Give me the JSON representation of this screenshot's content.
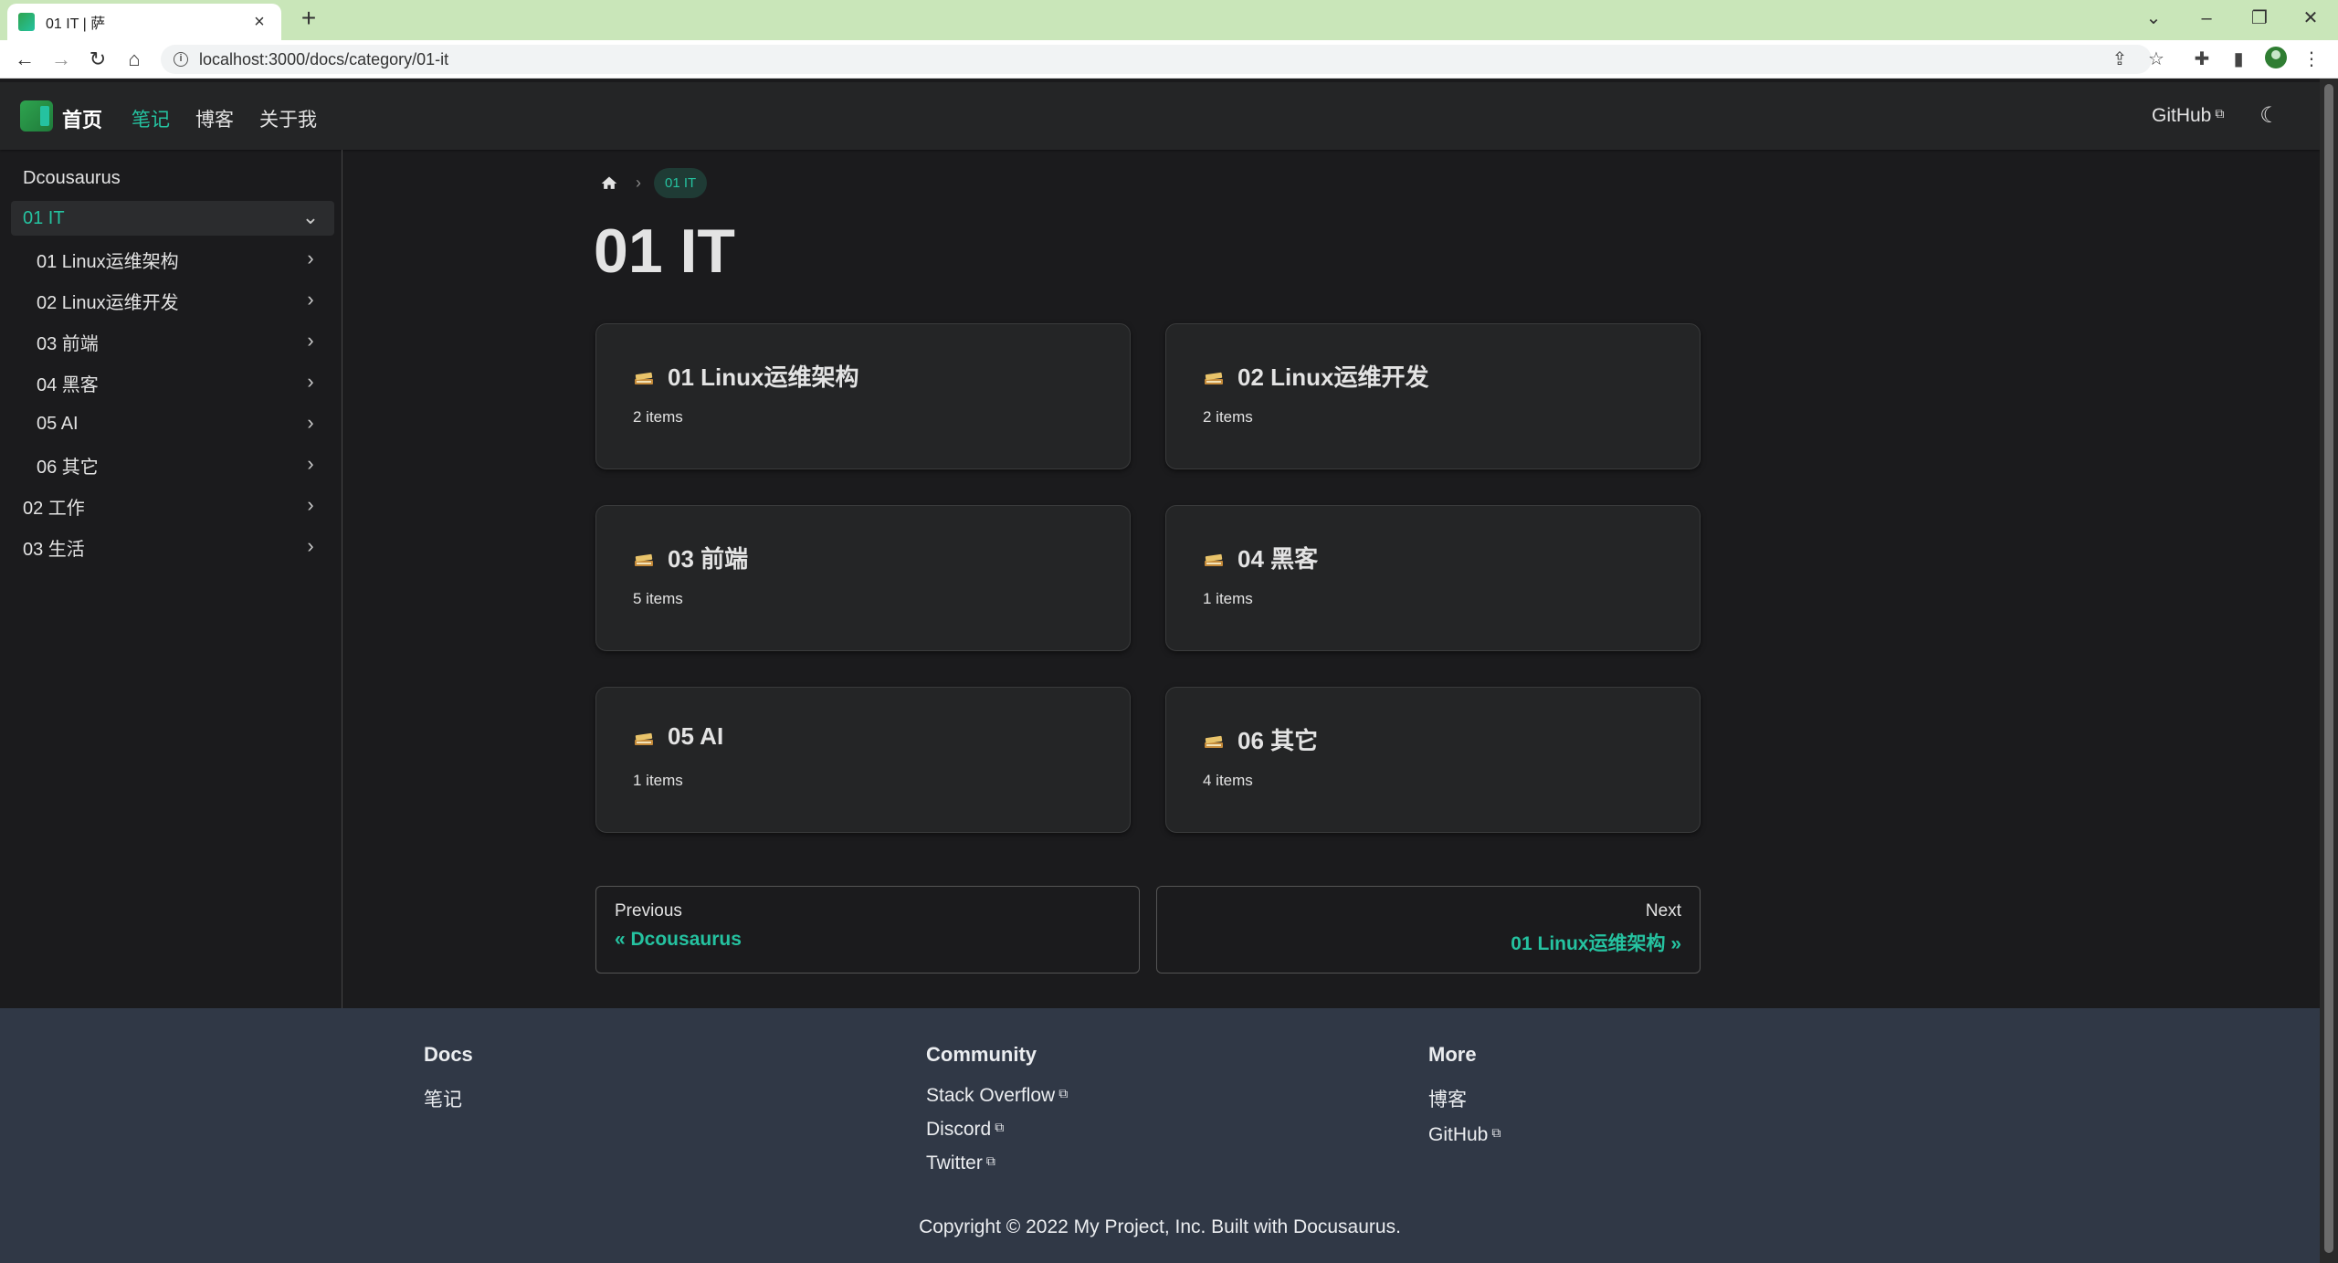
{
  "browser": {
    "tab_title": "01 IT | 萨",
    "url": "localhost:3000/docs/category/01-it"
  },
  "navbar": {
    "brand": "首页",
    "links": [
      "笔记",
      "博客",
      "关于我"
    ],
    "github": "GitHub"
  },
  "sidebar": {
    "items": [
      {
        "label": "Dcousaurus"
      },
      {
        "label": "01 IT"
      },
      {
        "label": "01 Linux运维架构"
      },
      {
        "label": "02 Linux运维开发"
      },
      {
        "label": "03 前端"
      },
      {
        "label": "04 黑客"
      },
      {
        "label": "05 AI"
      },
      {
        "label": "06 其它"
      },
      {
        "label": "02 工作"
      },
      {
        "label": "03 生活"
      }
    ]
  },
  "breadcrumb": {
    "current": "01 IT"
  },
  "page_title": "01 IT",
  "cards": [
    {
      "title": "01 Linux运维架构",
      "count": "2 items"
    },
    {
      "title": "02 Linux运维开发",
      "count": "2 items"
    },
    {
      "title": "03 前端",
      "count": "5 items"
    },
    {
      "title": "04 黑客",
      "count": "1 items"
    },
    {
      "title": "05 AI",
      "count": "1 items"
    },
    {
      "title": "06 其它",
      "count": "4 items"
    }
  ],
  "pagination": {
    "previous_label": "Previous",
    "previous_title": "« Dcousaurus",
    "next_label": "Next",
    "next_title": "01 Linux运维架构 »"
  },
  "footer": {
    "columns": [
      {
        "title": "Docs",
        "links": [
          "笔记"
        ]
      },
      {
        "title": "Community",
        "links": [
          "Stack Overflow",
          "Discord",
          "Twitter"
        ]
      },
      {
        "title": "More",
        "links": [
          "博客",
          "GitHub"
        ]
      }
    ],
    "copyright": "Copyright © 2022 My Project, Inc. Built with Docusaurus."
  },
  "colors": {
    "accent": "#25c2a0",
    "background": "#1b1b1d",
    "surface": "#242526",
    "footer": "#303846",
    "browser_frame": "#c9e6b9"
  }
}
